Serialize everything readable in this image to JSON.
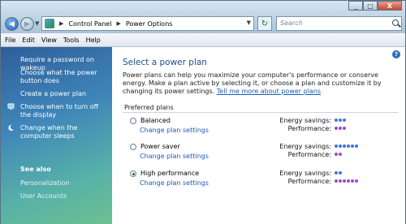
{
  "window": {
    "minimize": "_",
    "maximize": "□",
    "close": "X"
  },
  "address": {
    "crumbs": [
      "Control Panel",
      "Power Options"
    ],
    "search_placeholder": "Search"
  },
  "menu": [
    "File",
    "Edit",
    "View",
    "Tools",
    "Help"
  ],
  "sidebar": {
    "tasks": [
      {
        "label": "Require a password on wakeup",
        "icon": ""
      },
      {
        "label": "Choose what the power button does",
        "icon": ""
      },
      {
        "label": "Create a power plan",
        "icon": ""
      },
      {
        "label": "Choose when to turn off the display",
        "icon": "monitor-icon"
      },
      {
        "label": "Change when the computer sleeps",
        "icon": "moon-icon"
      }
    ],
    "see_also": "See also",
    "see_also_items": [
      "Personalization",
      "User Accounts"
    ]
  },
  "main": {
    "title": "Select a power plan",
    "intro": "Power plans can help you maximize your computer's performance or conserve energy. Make a plan active by selecting it, or choose a plan and customize it by changing its power settings.",
    "intro_link": "Tell me more about power plans",
    "group_label": "Preferred plans",
    "energy_label": "Energy savings:",
    "performance_label": "Performance:",
    "plans": [
      {
        "name": "Balanced",
        "link": "Change plan settings",
        "selected": false,
        "energy_dots": 3,
        "performance_dots": 3
      },
      {
        "name": "Power saver",
        "link": "Change plan settings",
        "selected": false,
        "energy_dots": 6,
        "performance_dots": 2
      },
      {
        "name": "High performance",
        "link": "Change plan settings",
        "selected": true,
        "energy_dots": 2,
        "performance_dots": 6
      }
    ]
  },
  "colors": {
    "energy_dot": "#3f78d8",
    "performance_dot": "#9a4cc9",
    "link": "#1a5bb5",
    "title": "#1f4d8f"
  }
}
